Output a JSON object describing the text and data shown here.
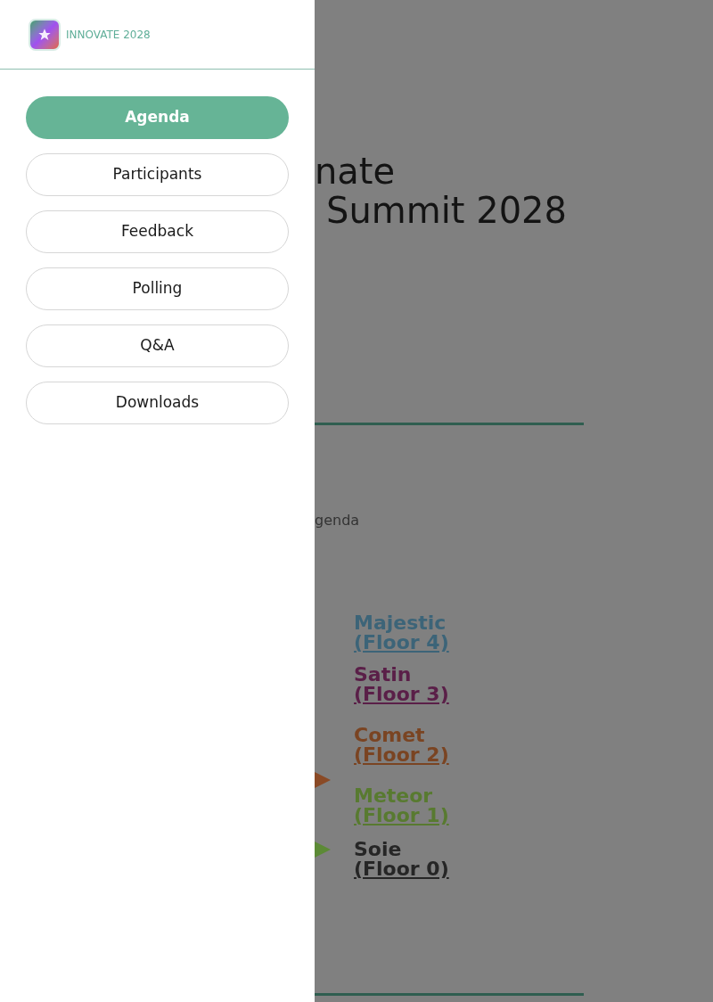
{
  "drawer": {
    "brand": "INNOVATE 2028",
    "nav": [
      {
        "label": "Agenda",
        "selected": true
      },
      {
        "label": "Participants",
        "selected": false
      },
      {
        "label": "Feedback",
        "selected": false
      },
      {
        "label": "Polling",
        "selected": false
      },
      {
        "label": "Q&A",
        "selected": false
      },
      {
        "label": "Downloads",
        "selected": false
      }
    ]
  },
  "page": {
    "title_lines": [
      "nate",
      "Summit 2028"
    ],
    "section_label": "genda",
    "rooms": [
      {
        "name": "Majestic",
        "floor": "(Floor 4)",
        "color": "#3c6478"
      },
      {
        "name": "Satin",
        "floor": "(Floor 3)",
        "color": "#5a1f48"
      },
      {
        "name": "Comet",
        "floor": "(Floor 2)",
        "color": "#7a4422"
      },
      {
        "name": "Meteor",
        "floor": "(Floor 1)",
        "color": "#587a30"
      },
      {
        "name": "Soie",
        "floor": "(Floor 0)",
        "color": "#262626"
      }
    ],
    "markers": [
      {
        "color": "#8a4a26"
      },
      {
        "color": "#5c8a36"
      }
    ]
  }
}
